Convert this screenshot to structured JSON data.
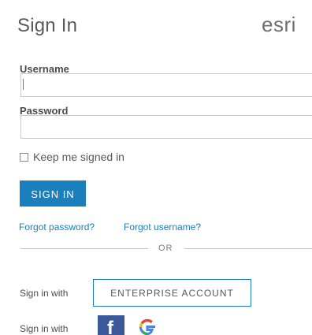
{
  "header": {
    "title": "Sign In",
    "brand": "esri"
  },
  "form": {
    "username_label": "Username",
    "username_value": "",
    "password_label": "Password",
    "password_value": "",
    "keep_signed_in_label": "Keep me signed in",
    "keep_signed_in_checked": false,
    "sign_in_button": "SIGN IN"
  },
  "links": {
    "forgot_password": "Forgot password?",
    "forgot_username": "Forgot username?"
  },
  "separator": {
    "text": "OR"
  },
  "alt_signin": {
    "enterprise_prefix": "Sign in with",
    "enterprise_button": "ENTERPRISE ACCOUNT",
    "social_prefix": "Sign in with",
    "providers": [
      "facebook-icon",
      "google-icon"
    ]
  },
  "colors": {
    "accent": "#1a7fbd",
    "facebook": "#3b5998",
    "google_blue": "#4285f4",
    "google_red": "#ea4335",
    "google_yellow": "#fbbc05",
    "google_green": "#34a853"
  }
}
